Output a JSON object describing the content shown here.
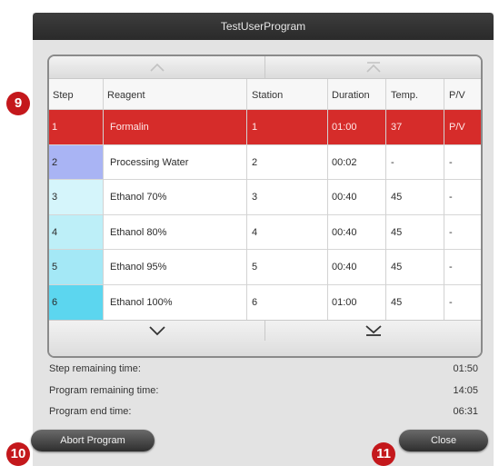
{
  "dialog": {
    "title": "TestUserProgram"
  },
  "table": {
    "columns": [
      "Step",
      "Reagent",
      "Station",
      "Duration",
      "Temp.",
      "P/V"
    ],
    "rows": [
      {
        "step": "1",
        "reagent": "Formalin",
        "station": "1",
        "duration": "01:00",
        "temp": "37",
        "pv": "P/V",
        "color": "#d62c2a"
      },
      {
        "step": "2",
        "reagent": "Processing Water",
        "station": "2",
        "duration": "00:02",
        "temp": "-",
        "pv": "-",
        "color": "#a9b4f4"
      },
      {
        "step": "3",
        "reagent": "Ethanol 70%",
        "station": "3",
        "duration": "00:40",
        "temp": "45",
        "pv": "-",
        "color": "#d5f5fb"
      },
      {
        "step": "4",
        "reagent": "Ethanol 80%",
        "station": "4",
        "duration": "00:40",
        "temp": "45",
        "pv": "-",
        "color": "#bdeff8"
      },
      {
        "step": "5",
        "reagent": "Ethanol 95%",
        "station": "5",
        "duration": "00:40",
        "temp": "45",
        "pv": "-",
        "color": "#a4e8f6"
      },
      {
        "step": "6",
        "reagent": "Ethanol 100%",
        "station": "6",
        "duration": "01:00",
        "temp": "45",
        "pv": "-",
        "color": "#5cd6ef"
      }
    ],
    "selected_row": 0
  },
  "info": {
    "step_remaining_label": "Step remaining time:",
    "step_remaining_value": "01:50",
    "program_remaining_label": "Program remaining time:",
    "program_remaining_value": "14:05",
    "program_end_label": "Program end time:",
    "program_end_value": "06:31"
  },
  "buttons": {
    "abort_label": "Abort Program",
    "close_label": "Close"
  },
  "callouts": {
    "c9": "9",
    "c10": "10",
    "c11": "11"
  },
  "icons": {
    "scroll_up": "chevron-up-icon",
    "scroll_top": "scroll-to-top-icon",
    "scroll_down": "chevron-down-icon",
    "scroll_bottom": "scroll-to-bottom-icon"
  },
  "colors": {
    "selected_row": "#d62c2a",
    "callout": "#c4181c",
    "titlebar": "#2f2f2f"
  }
}
